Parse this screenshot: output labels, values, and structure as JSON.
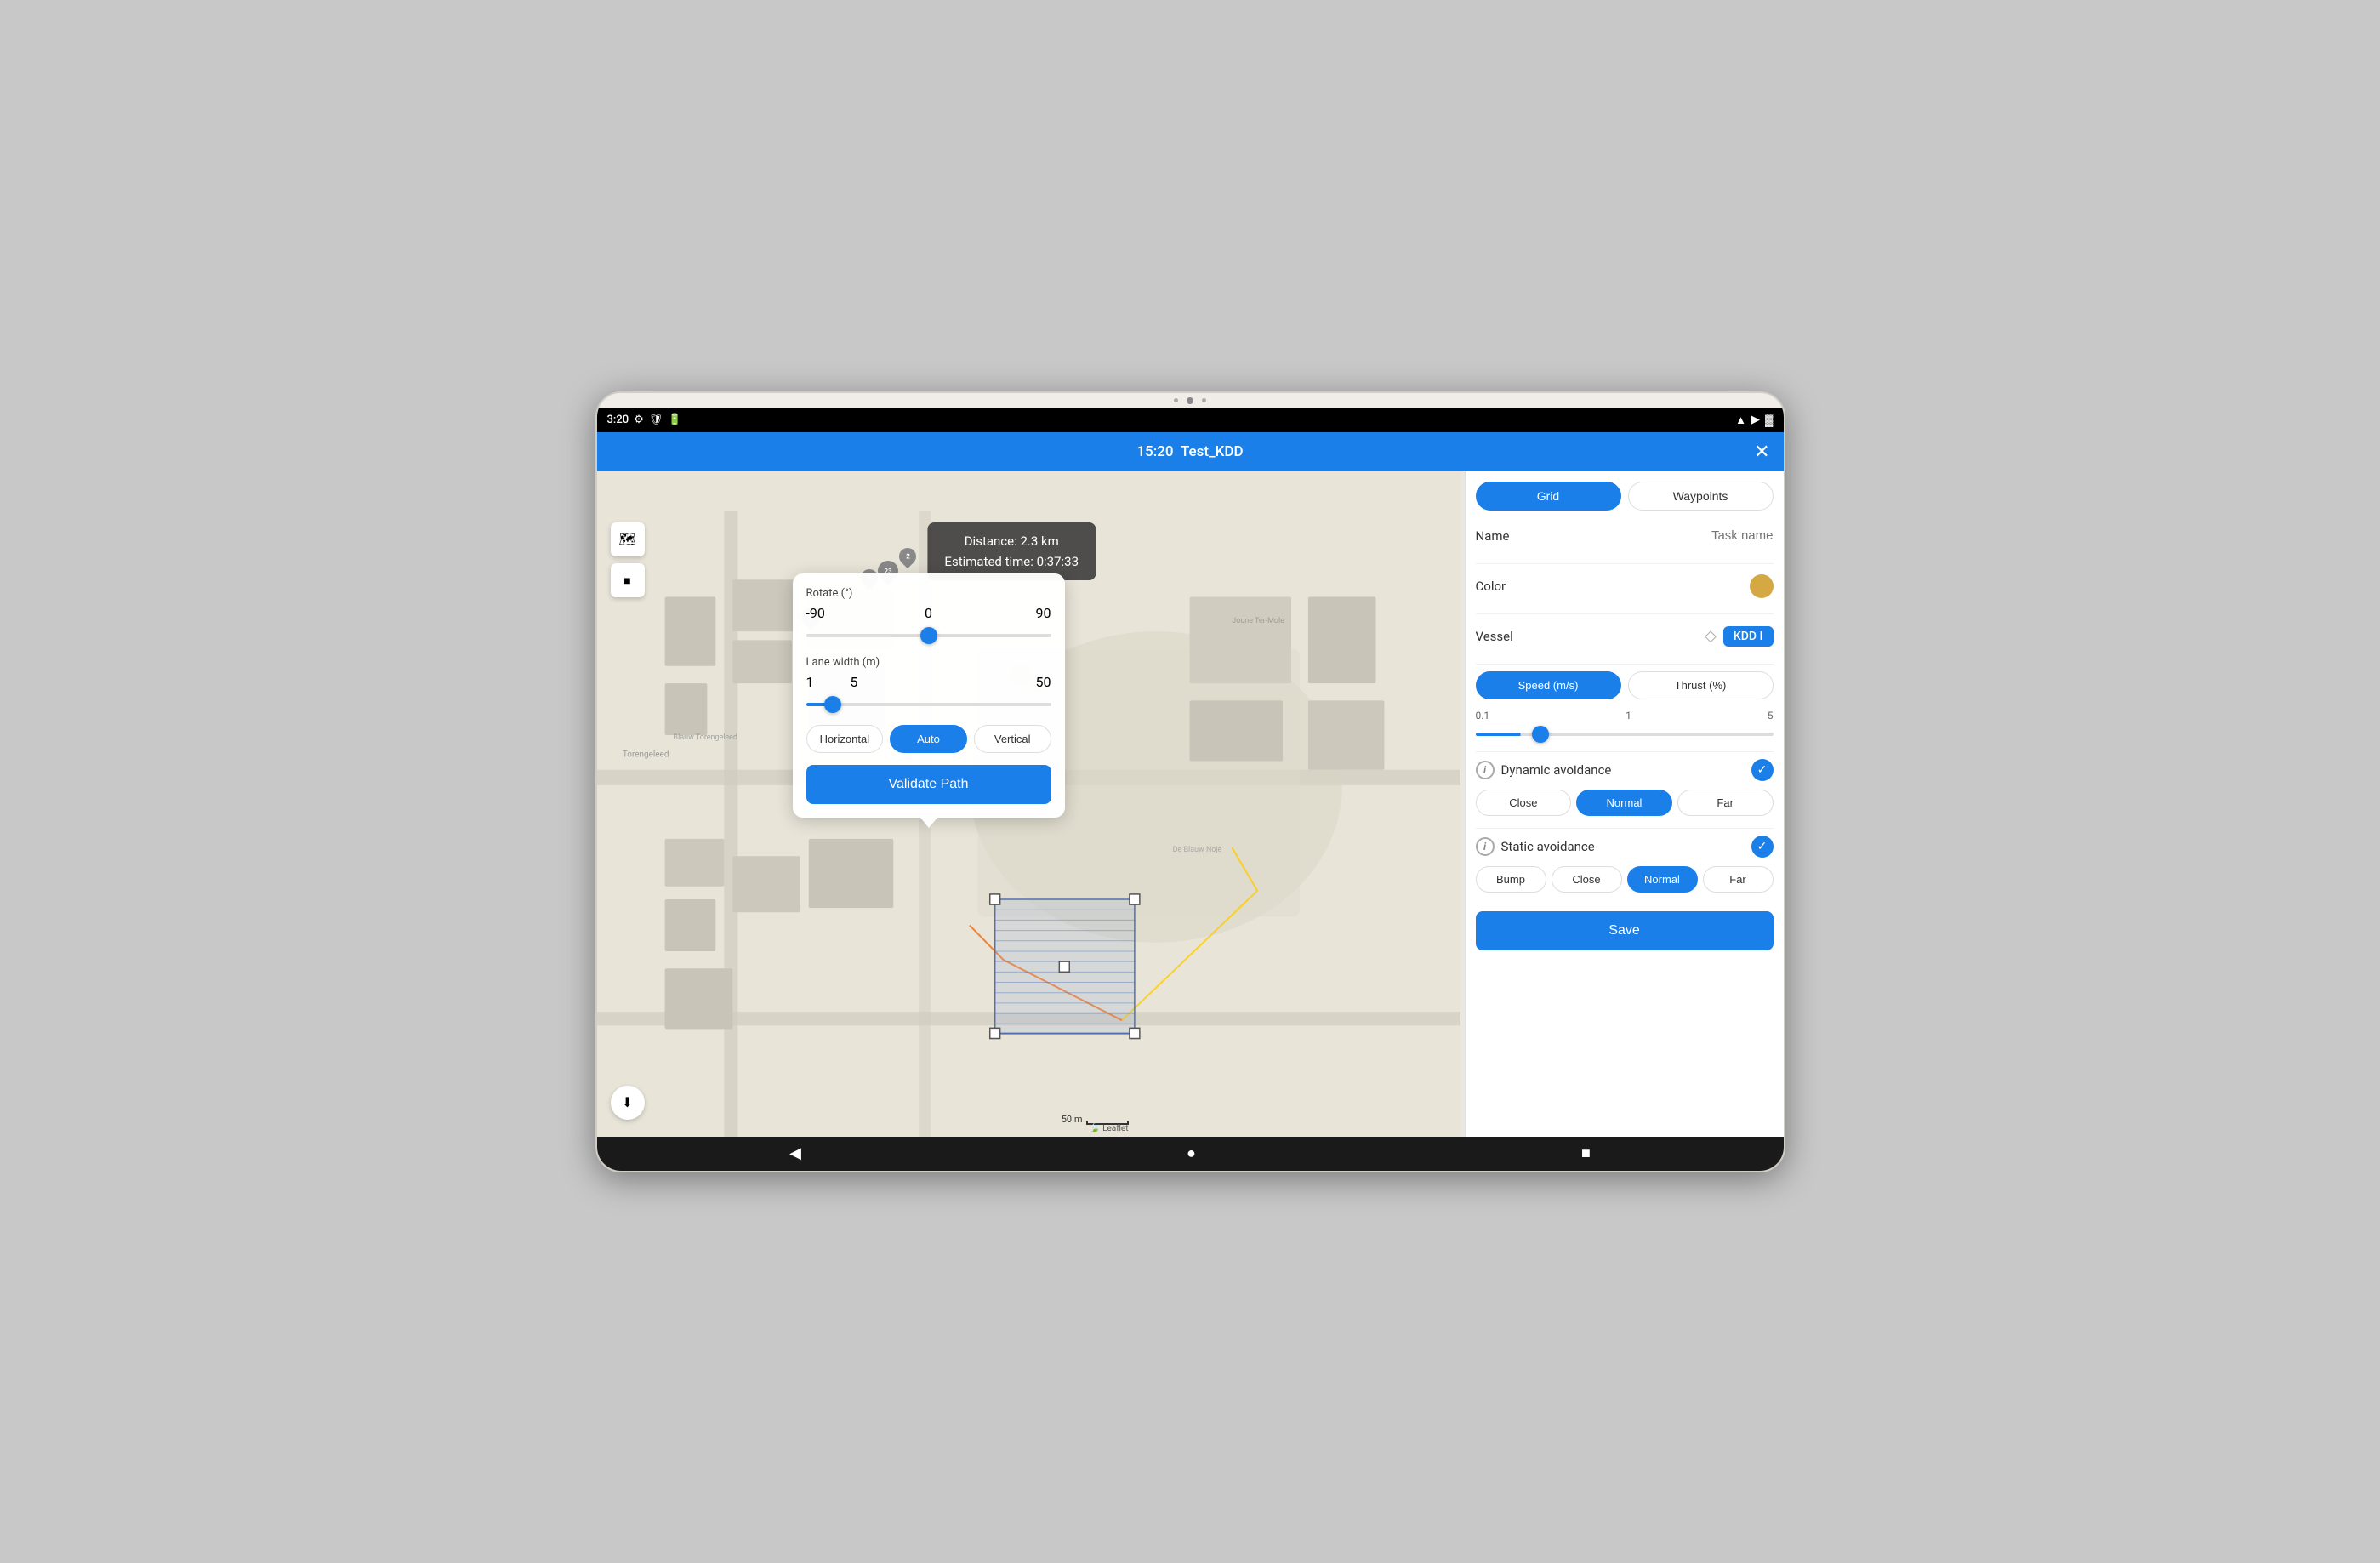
{
  "tablet": {
    "time": "3:20",
    "app_time": "15:20",
    "app_title": "Test_KDD"
  },
  "info_box": {
    "distance_label": "Distance: 2.3 km",
    "time_label": "Estimated time: 0:37:33"
  },
  "popup": {
    "rotate_label": "Rotate (°)",
    "rotate_min": "-90",
    "rotate_max": "90",
    "rotate_center": "0",
    "rotate_value": 0,
    "lane_label": "Lane width (m)",
    "lane_min": "1",
    "lane_max": "50",
    "lane_value": "5",
    "orientation_buttons": [
      "Horizontal",
      "Auto",
      "Vertical"
    ],
    "orientation_active": "Auto",
    "validate_btn": "Validate Path"
  },
  "right_panel": {
    "tab_grid": "Grid",
    "tab_waypoints": "Waypoints",
    "active_tab": "Grid",
    "name_label": "Name",
    "name_placeholder": "Task name",
    "color_label": "Color",
    "vessel_label": "Vessel",
    "vessel_badge": "KDD I",
    "speed_tab": "Speed (m/s)",
    "thrust_tab": "Thrust (%)",
    "active_speed_tab": "Speed (m/s)",
    "speed_min": "0.1",
    "speed_max": "5",
    "speed_value": "1",
    "dynamic_avoidance_label": "Dynamic avoidance",
    "dynamic_avoidance_checked": true,
    "dynamic_btns": [
      "Close",
      "Normal",
      "Far"
    ],
    "dynamic_active": "Normal",
    "static_avoidance_label": "Static avoidance",
    "static_avoidance_checked": true,
    "static_btns": [
      "Bump",
      "Close",
      "Normal",
      "Far"
    ],
    "static_active": "Normal",
    "save_btn": "Save"
  },
  "map_scale": {
    "label": "50 m"
  },
  "leaflet": "Leaflet",
  "bottom_nav": {
    "back": "◀",
    "home": "●",
    "square": "■"
  },
  "icons": {
    "close": "✕",
    "layers": "≡",
    "stop": "■",
    "download": "⬇",
    "info": "i",
    "check": "✓",
    "wifi": "▲",
    "battery": "▓"
  }
}
